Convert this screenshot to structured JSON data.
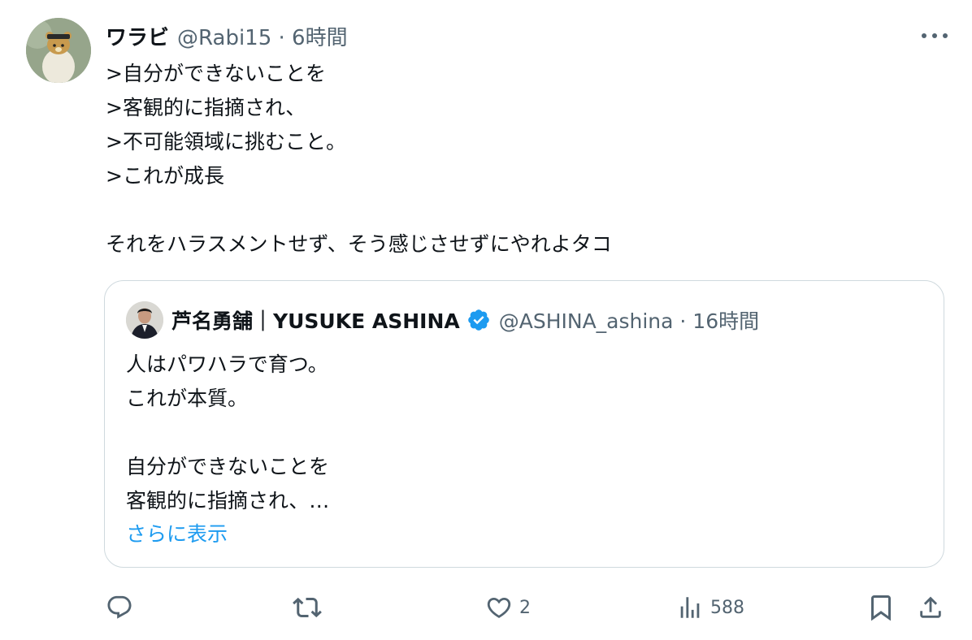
{
  "tweet": {
    "display_name": "ワラビ",
    "meta": "@Rabi15 · 6時間",
    "body": ">自分ができないことを\n>客観的に指摘され、\n>不可能領域に挑むこと。\n>これが成長\n\nそれをハラスメントせず、そう感じさせずにやれよタコ",
    "more_icon": "more-horizontal-icon"
  },
  "quote": {
    "display_name": "芦名勇舗｜YUSUKE ASHINA",
    "meta": "@ASHINA_ashina · 16時間",
    "body": "人はパワハラで育つ。\nこれが本質。\n\n自分ができないことを\n客観的に指摘され、…",
    "show_more": "さらに表示",
    "verified_color": "#1d9bf0"
  },
  "actions": {
    "reply_count": "",
    "retweet_count": "",
    "like_count": "2",
    "views_count": "588"
  },
  "colors": {
    "text": "#0f1419",
    "secondary": "#536471",
    "link": "#1d9bf0",
    "border": "#cfd9de"
  }
}
